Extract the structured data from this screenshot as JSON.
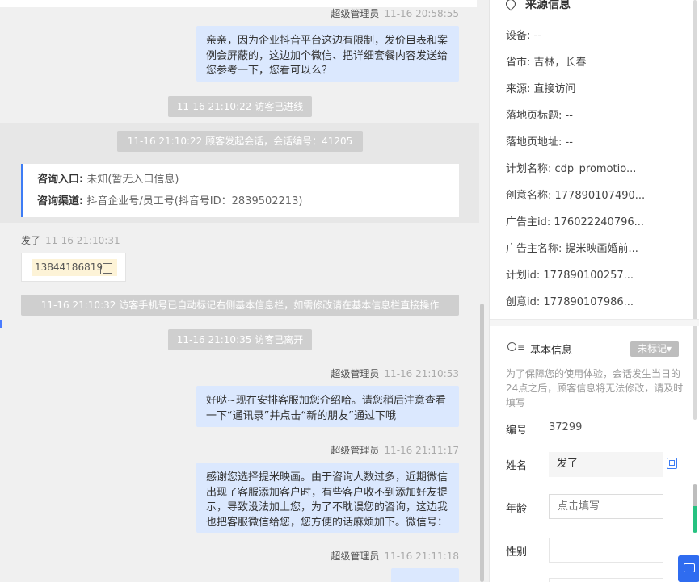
{
  "chat": {
    "messages": [
      {
        "sender": "超级管理员",
        "time": "11-16 20:58:55",
        "text": "亲亲，因为企业抖音平台这边有限制，发价目表和案例会屏蔽的，这边加个微信、把详细套餐内容发送给您参考一下，您看可以么？"
      },
      {
        "sender": "超级管理员",
        "time": "11-16 21:10:53",
        "text": "好哒~现在安排客服加您介绍哈。请您稍后注意查看一下“通讯录”并点击“新的朋友”通过下哦"
      },
      {
        "sender": "超级管理员",
        "time": "11-16 21:11:17",
        "text": "感谢您选择提米映画。由于咨询人数过多，近期微信出现了客服添加客户时，有些客户收不到添加好友提示，导致没法加上您，为了不耽误您的咨询，这边我也把客服微信给您，您方便的话麻烦加下。微信号："
      },
      {
        "sender": "超级管理员",
        "time": "11-16 21:11:18",
        "text": ""
      }
    ],
    "system": {
      "visitor_joined": "11-16 21:10:22 访客已进线",
      "session_started": "11-16 21:10:22 顾客发起会话，会话编号：41205",
      "phone_marked": "11-16 21:10:32 访客手机号已自动标记右侧基本信息栏，如需修改请在基本信息栏直接操作",
      "visitor_left": "11-16 21:10:35 访客已离开"
    },
    "info_card": {
      "entry_label": "咨询入口:",
      "entry_value": "未知(暂无入口信息)",
      "channel_label": "咨询渠道:",
      "channel_value": "抖音企业号/员工号(抖音号ID：2839502213)"
    },
    "visitor": {
      "name": "发了",
      "time": "11-16 21:10:31",
      "phone": "13844186819"
    }
  },
  "panel": {
    "source": {
      "title": "来源信息",
      "rows": [
        "设备: --",
        "省市: 吉林，长春",
        "来源: 直接访问",
        "落地页标题: --",
        "落地页地址: --",
        "计划名称: cdp_promotio...",
        "创意名称: 177890107490...",
        "广告主id: 176022240796...",
        "广告主名称: 提米映画婚前...",
        "计划id: 177890100257...",
        "创意id: 177890107986..."
      ]
    },
    "basic": {
      "title": "基本信息",
      "tag_label": "未标记▾",
      "note": "为了保障您的使用体验，会话发生当日的24点之后，顾客信息将无法修改，请及时填写",
      "id_label": "编号",
      "id_value": "37299",
      "name_label": "姓名",
      "name_value": "发了",
      "age_label": "年龄",
      "age_placeholder": "点击填写",
      "gender_label": "性别"
    }
  },
  "colors": {
    "accent": "#3d7cf5",
    "bubble": "#dbe8fe",
    "system": "#cfcfcf"
  }
}
